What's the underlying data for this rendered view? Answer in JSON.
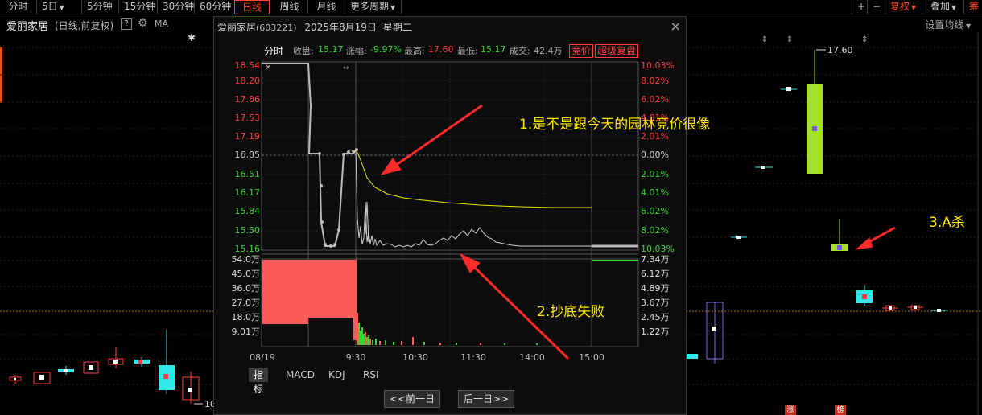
{
  "toolbar": {
    "left_items": [
      "分时",
      "5日",
      "5分钟",
      "15分钟",
      "30分钟",
      "60分钟",
      "日线",
      "周线",
      "月线",
      "更多周期"
    ],
    "active": "日线",
    "right_items": [
      "+",
      "−",
      "复权",
      "叠加",
      "筹"
    ]
  },
  "header": {
    "stock_name": "爱丽家居",
    "sub": "(日线,前复权)",
    "help": "?",
    "ma": "MA",
    "set_ma": "设置均线"
  },
  "main_chart": {
    "high_label": "17.60",
    "low_label": "10",
    "badges": [
      "涨",
      "榜"
    ]
  },
  "popup": {
    "title": "爱丽家居",
    "code": "(603221)",
    "date": "2025年8月19日",
    "weekday": "星期二",
    "close_icon": "×",
    "tab": "分时",
    "stats": {
      "close_label": "收盘:",
      "close_value": "15.17",
      "change_label": "涨幅:",
      "change_value": "-9.97%",
      "high_label": "最高:",
      "high_value": "17.60",
      "low_label": "最低:",
      "low_value": "15.17",
      "volume_label": "成交:",
      "volume_value": "42.4万"
    },
    "badges": [
      "竞价",
      "超级复盘"
    ],
    "price_axis": [
      "18.54",
      "18.20",
      "17.86",
      "17.53",
      "17.19",
      "16.85",
      "16.51",
      "16.17",
      "15.84",
      "15.50",
      "15.16"
    ],
    "pct_axis": [
      "10.03%",
      "8.02%",
      "6.02%",
      "4.01%",
      "2.01%",
      "0.00%",
      "2.01%",
      "4.01%",
      "6.02%",
      "8.02%",
      "10.03%"
    ],
    "vol_axis_left": [
      "54.0万",
      "45.0万",
      "36.0万",
      "27.0万",
      "18.0万",
      "9.01万"
    ],
    "vol_axis_right": [
      "7.34万",
      "6.12万",
      "4.89万",
      "3.67万",
      "2.45万",
      "1.22万"
    ],
    "time_axis": [
      "08/19",
      "9:30",
      "10:30",
      "11:30",
      "14:00",
      "15:00"
    ],
    "indicator_tabs": [
      "指标",
      "MACD",
      "KDJ",
      "RSI"
    ],
    "indicator_active": "指标",
    "prev_day": "<<前一日",
    "next_day": "后一日>>"
  },
  "annotations": {
    "a1": "1.是不是跟今天的园林竞价很像",
    "a2": "2.抄底失败",
    "a3": "3.A杀"
  },
  "colors": {
    "up": "#ff3b3b",
    "down": "#2fd82f",
    "accent": "#ff4b2b",
    "annotation": "#ffe600",
    "avg_line": "#e6e600"
  }
}
